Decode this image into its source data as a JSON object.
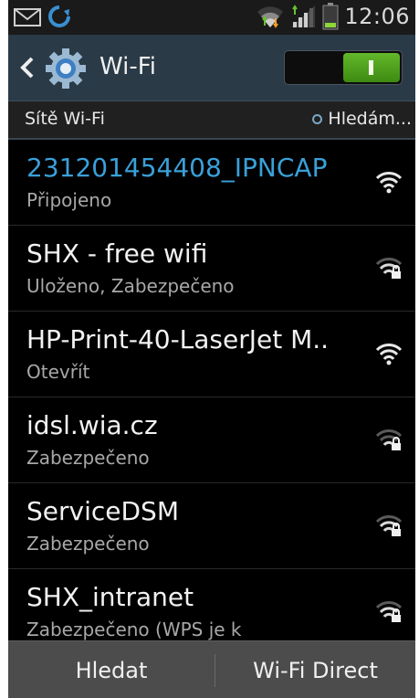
{
  "status_bar": {
    "time": "12:06",
    "icons": [
      "mail-icon",
      "sync-icon",
      "wifi-signal-icon",
      "cell-signal-icon",
      "battery-icon"
    ]
  },
  "action_bar": {
    "title": "Wi-Fi",
    "toggle_state": "on",
    "accent_color": "#4aa11a"
  },
  "section": {
    "title": "Sítě Wi-Fi",
    "scanning_label": "Hledám..."
  },
  "networks": [
    {
      "name": "231201454408_IPNCAP",
      "status": "Připojeno",
      "secured": false,
      "connected": true
    },
    {
      "name": "SHX - free wifi",
      "status": "Uloženo, Zabezpečeno",
      "secured": true,
      "connected": false
    },
    {
      "name": "HP-Print-40-LaserJet M..",
      "status": "Otevřít",
      "secured": false,
      "connected": false
    },
    {
      "name": "idsl.wia.cz",
      "status": "Zabezpečeno",
      "secured": true,
      "connected": false
    },
    {
      "name": "ServiceDSM",
      "status": "Zabezpečeno",
      "secured": true,
      "connected": false
    },
    {
      "name": "SHX_intranet",
      "status": "Zabezpečeno (WPS je k",
      "secured": true,
      "connected": false
    }
  ],
  "bottom_bar": {
    "scan_label": "Hledat",
    "direct_label": "Wi-Fi Direct"
  },
  "colors": {
    "connected_text": "#3aa0d9",
    "action_bar_bg": "#2a3a47"
  }
}
